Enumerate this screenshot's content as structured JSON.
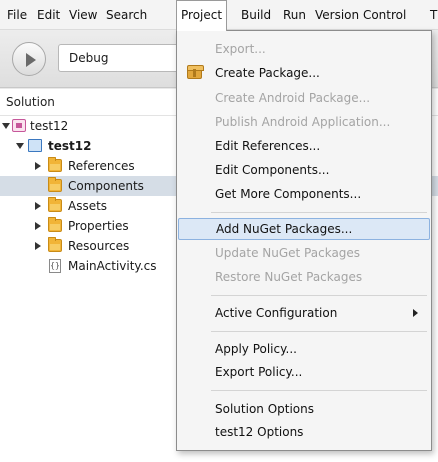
{
  "menubar": {
    "file": "File",
    "edit": "Edit",
    "view": "View",
    "search": "Search",
    "project": "Project",
    "build": "Build",
    "run": "Run",
    "version_control": "Version Control",
    "tools_partial": "T"
  },
  "toolbar": {
    "run_icon": "play-icon",
    "configuration": "Debug"
  },
  "solution_pane": {
    "title": "Solution",
    "tree": [
      {
        "label": "test12",
        "icon": "solution-icon",
        "expanded": true
      },
      {
        "label": "test12",
        "icon": "project-icon",
        "expanded": true,
        "bold": true
      },
      {
        "label": "References",
        "icon": "folder-icon",
        "expanded": false
      },
      {
        "label": "Components",
        "icon": "folder-icon",
        "selected": true
      },
      {
        "label": "Assets",
        "icon": "folder-icon",
        "expanded": false
      },
      {
        "label": "Properties",
        "icon": "folder-icon",
        "expanded": false
      },
      {
        "label": "Resources",
        "icon": "folder-icon",
        "expanded": false
      },
      {
        "label": "MainActivity.cs",
        "icon": "csharp-file-icon"
      }
    ]
  },
  "project_menu": {
    "items": [
      {
        "label": "Export...",
        "enabled": false
      },
      {
        "label": "Create Package...",
        "enabled": true,
        "icon": "package-icon"
      },
      {
        "label": "Create Android Package...",
        "enabled": false
      },
      {
        "label": "Publish Android Application...",
        "enabled": false
      },
      {
        "label": "Edit References...",
        "enabled": true
      },
      {
        "label": "Edit Components...",
        "enabled": true
      },
      {
        "label": "Get More Components...",
        "enabled": true
      },
      {
        "label": "Add NuGet Packages...",
        "enabled": true,
        "highlighted": true
      },
      {
        "label": "Update NuGet Packages",
        "enabled": false
      },
      {
        "label": "Restore NuGet Packages",
        "enabled": false
      },
      {
        "label": "Active Configuration",
        "enabled": true,
        "submenu": true
      },
      {
        "label": "Apply Policy...",
        "enabled": true
      },
      {
        "label": "Export Policy...",
        "enabled": true
      },
      {
        "label": "Solution Options",
        "enabled": true
      },
      {
        "label": "test12 Options",
        "enabled": true
      }
    ]
  },
  "colors": {
    "selection": "#d5dde6",
    "menu_highlight": "#dce8f6",
    "disabled_text": "#a4a4a4"
  }
}
